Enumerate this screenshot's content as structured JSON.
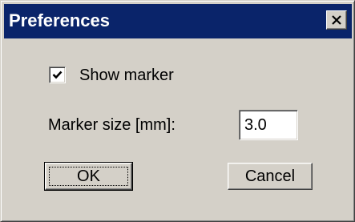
{
  "window": {
    "title": "Preferences",
    "close_icon": "close-icon"
  },
  "form": {
    "show_marker": {
      "label": "Show marker",
      "checked": true
    },
    "marker_size": {
      "label": "Marker size [mm]:",
      "value": "3.0"
    }
  },
  "buttons": {
    "ok_label": "OK",
    "cancel_label": "Cancel"
  },
  "colors": {
    "title_bar": "#0a246a",
    "face": "#d4d0c8"
  }
}
